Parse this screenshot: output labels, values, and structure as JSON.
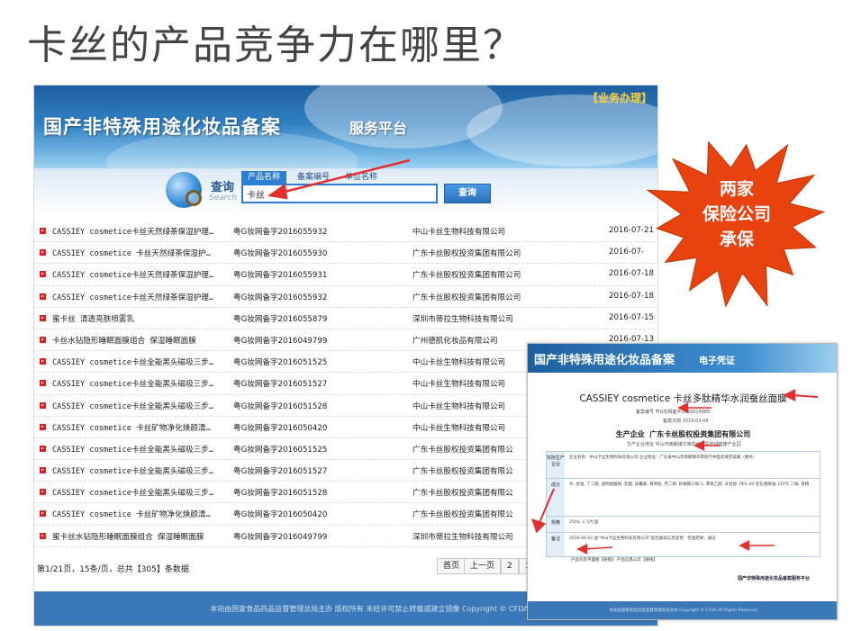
{
  "slide": {
    "title": "卡丝的产品竞争力在哪里？"
  },
  "banner": {
    "biz_link": "【业务办理】",
    "site_title": "国产非特殊用途化妆品备案",
    "site_subtitle": "服务平台"
  },
  "search": {
    "label": "查询",
    "label_en": "Search",
    "tabs": [
      "产品名称",
      "备案编号",
      "单位名称"
    ],
    "value": "卡丝",
    "button": "查询"
  },
  "results": [
    {
      "name": "CASSIEY cosmetice卡丝天然绿茶保湿护理…",
      "record_no": "粤G妆网备字2016055932",
      "company": "中山卡丝生物科技有限公司",
      "date": "2016-07-21"
    },
    {
      "name": "CASSIEY cosmetice 卡丝天然绿茶保湿护…",
      "record_no": "粤G妆网备字2016055930",
      "company": "广东卡丝股权投资集团有限公司",
      "date": "2016-07-"
    },
    {
      "name": "CASSIEY cosmetice卡丝天然绿茶保湿护理…",
      "record_no": "粤G妆网备字2016055931",
      "company": "广东卡丝股权投资集团有限公司",
      "date": "2016-07-18"
    },
    {
      "name": "CASSIEY cosmetice卡丝天然绿茶保湿护理…",
      "record_no": "粤G妆网备字2016055932",
      "company": "广东卡丝股权投资集团有限公司",
      "date": "2016-07-18"
    },
    {
      "name": "蜜卡丝 清透亮肤喷雾乳",
      "record_no": "粤G妆网备字2016055879",
      "company": "深圳市蒂拉生物科技有限公司",
      "date": "2016-07-15"
    },
    {
      "name": "卡丝水钻隐形睡眠面膜组合 保湿睡眠面膜",
      "record_no": "粤G妆网备字2016049799",
      "company": "广州德肌化妆品有限公司",
      "date": "2016-07-13"
    },
    {
      "name": "CASSIEY cosmetice卡丝全能黑头磁吸三步…",
      "record_no": "粤G妆网备字2016051525",
      "company": "中山卡丝生物科技有限公司",
      "date": ""
    },
    {
      "name": "CASSIEY cosmetice卡丝全能黑头磁吸三步…",
      "record_no": "粤G妆网备字2016051527",
      "company": "中山卡丝生物科技有限公司",
      "date": ""
    },
    {
      "name": "CASSIEY cosmetice卡丝全能黑头磁吸三步…",
      "record_no": "粤G妆网备字2016051528",
      "company": "中山卡丝生物科技有限公司",
      "date": ""
    },
    {
      "name": "CASSIEY cosmetice 卡丝矿物净化焕颜清…",
      "record_no": "粤G妆网备字2016050420",
      "company": "中山卡丝生物科技有限公司",
      "date": ""
    },
    {
      "name": "CASSIEY cosmetice卡丝全能黑头磁吸三步…",
      "record_no": "粤G妆网备字2016051525",
      "company": "广东卡丝股权投资集团有限公",
      "date": ""
    },
    {
      "name": "CASSIEY cosmetice卡丝全能黑头磁吸三步…",
      "record_no": "粤G妆网备字2016051527",
      "company": "广东卡丝股权投资集团有限公",
      "date": ""
    },
    {
      "name": "CASSIEY cosmetice卡丝全能黑头磁吸三步…",
      "record_no": "粤G妆网备字2016051528",
      "company": "广东卡丝股权投资集团有限公",
      "date": ""
    },
    {
      "name": "CASSIEY cosmetice 卡丝矿物净化焕颜清…",
      "record_no": "粤G妆网备字2016050420",
      "company": "广东卡丝股权投资集团有限公",
      "date": ""
    },
    {
      "name": "蜜卡丝水钻隐形睡眠面膜组合 保湿睡眠面膜",
      "record_no": "粤G妆网备字2016049799",
      "company": "深圳市蒂拉生物科技有限公司",
      "date": ""
    }
  ],
  "pager": {
    "info": "第1/21页，15条/页，总共【305】条数据",
    "first": "首页",
    "prev": "上一页",
    "p2": "2",
    "p3": "3"
  },
  "footer": "本站由国家食品药品监督管理总局主办 版权所有 未经许可禁止转载或建立镜像 Copyright © CFDA All Rights Reserved",
  "certificate": {
    "title": "国产非特殊用途化妆品备案",
    "subtitle": "电子凭证",
    "product": "CASSIEY cosmetice 卡丝多肽精华水润蚕丝面膜",
    "record_no": "备案编号  粤G妆网备字2016014888",
    "record_date": "备案日期  2016-03-08",
    "company_label": "生产企业",
    "company": "广东卡丝股权投资集团有限公司",
    "company_addr": "生产企业地址  中山市南朗镇华南现代中医药城健康产业园",
    "rows": [
      {
        "label": "实际生产企业",
        "value": "企业名称：中山卡丝生物科技有限公司  企业地址：广东省中山市南朗镇华南现代中医药城完美路（委托）"
      },
      {
        "label": "成分",
        "value": "水, 甘油, 丁二醇, 透明质酸钠, 乳酸, 尿囊素, 黄原胶, 丙二醇, 棕榈酰三肽-5, 苯氧乙醇, 辛甘醇, PEG-40 氢化蓖麻油, EDTA 二钠, 香精"
      },
      {
        "label": "规格",
        "value": "25mL × 5片/盒"
      },
      {
        "label": "备注",
        "value": "2016-06-02 由“中山卡丝生物科技有限公司”提出备案信息变更：检查结果：通过"
      }
    ],
    "foot_link": "产品包装平面图【链接】 产品信息公示【链接】",
    "foot_right": "国产非特殊用途化妆品备案服务平台",
    "footer": "本站由国家食品药品监督管理总局主办 Copyright © CFDA All Rights Reserved"
  },
  "callout": {
    "line1": "两家",
    "line2": "保险公司",
    "line3": "承保",
    "color": "#e8420f"
  },
  "arrow_color": "#e23030"
}
